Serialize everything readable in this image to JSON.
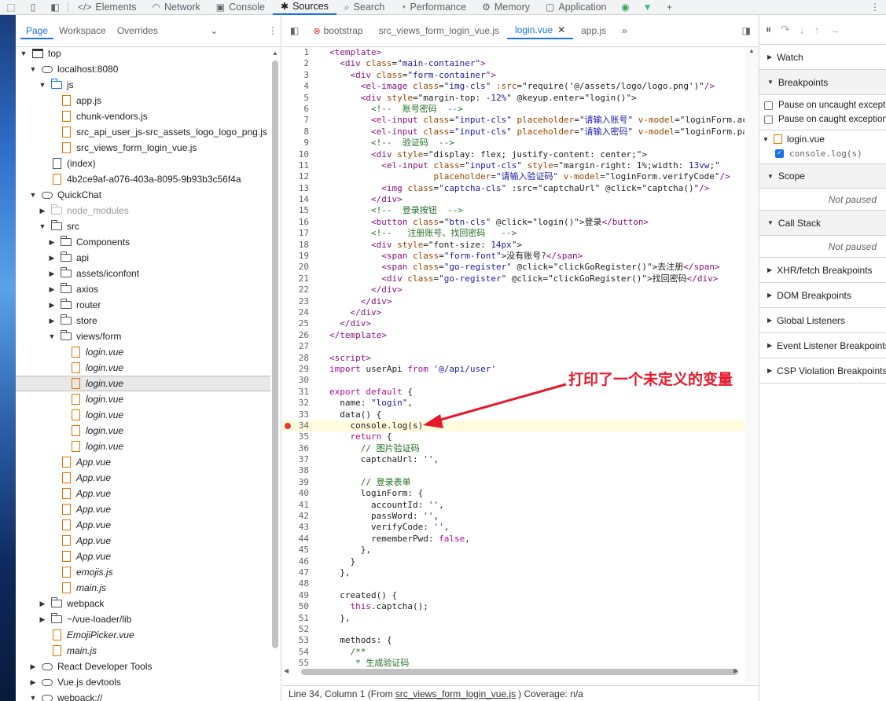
{
  "toolbar": {
    "tabs": [
      {
        "label": "Elements",
        "icon": "code-icon"
      },
      {
        "label": "Network",
        "icon": "wifi-icon"
      },
      {
        "label": "Console",
        "icon": "console-icon"
      },
      {
        "label": "Sources",
        "icon": "bug-icon"
      },
      {
        "label": "Search",
        "icon": "search-icon"
      },
      {
        "label": "Performance",
        "icon": "performance-icon"
      },
      {
        "label": "Memory",
        "icon": "memory-icon"
      },
      {
        "label": "Application",
        "icon": "application-icon"
      }
    ],
    "active_tab": "Sources",
    "add": "+",
    "more": "⋮"
  },
  "navigator": {
    "tabs": [
      "Page",
      "Workspace",
      "Overrides"
    ],
    "active_tab": "Page",
    "tree": [
      {
        "label": "top",
        "depth": 0,
        "icon": "frame",
        "open": true
      },
      {
        "label": "localhost:8080",
        "depth": 1,
        "icon": "cloud",
        "open": true
      },
      {
        "label": "js",
        "depth": 2,
        "icon": "folder-blue",
        "open": true
      },
      {
        "label": "app.js",
        "depth": 3,
        "icon": "file-orange"
      },
      {
        "label": "chunk-vendors.js",
        "depth": 3,
        "icon": "file-orange"
      },
      {
        "label": "src_api_user_js-src_assets_logo_logo_png.js",
        "depth": 3,
        "icon": "file-orange"
      },
      {
        "label": "src_views_form_login_vue.js",
        "depth": 3,
        "icon": "file-orange"
      },
      {
        "label": "(index)",
        "depth": 2,
        "icon": "file"
      },
      {
        "label": "4b2ce9af-a076-403a-8095-9b93b3c56f4a",
        "depth": 2,
        "icon": "file-orange"
      },
      {
        "label": "QuickChat",
        "depth": 1,
        "icon": "cloud",
        "open": true
      },
      {
        "label": "node_modules",
        "depth": 2,
        "icon": "folder-grey",
        "open": false,
        "dim": true
      },
      {
        "label": "src",
        "depth": 2,
        "icon": "folder",
        "open": true
      },
      {
        "label": "Components",
        "depth": 3,
        "icon": "folder",
        "open": false
      },
      {
        "label": "api",
        "depth": 3,
        "icon": "folder",
        "open": false
      },
      {
        "label": "assets/iconfont",
        "depth": 3,
        "icon": "folder",
        "open": false
      },
      {
        "label": "axios",
        "depth": 3,
        "icon": "folder",
        "open": false
      },
      {
        "label": "router",
        "depth": 3,
        "icon": "folder",
        "open": false
      },
      {
        "label": "store",
        "depth": 3,
        "icon": "folder",
        "open": false
      },
      {
        "label": "views/form",
        "depth": 3,
        "icon": "folder",
        "open": true
      },
      {
        "label": "login.vue",
        "depth": 4,
        "icon": "file-orange",
        "italic": true
      },
      {
        "label": "login.vue",
        "depth": 4,
        "icon": "file-orange",
        "italic": true
      },
      {
        "label": "login.vue",
        "depth": 4,
        "icon": "file-orange",
        "italic": true,
        "selected": true
      },
      {
        "label": "login.vue",
        "depth": 4,
        "icon": "file-orange",
        "italic": true
      },
      {
        "label": "login.vue",
        "depth": 4,
        "icon": "file-orange",
        "italic": true
      },
      {
        "label": "login.vue",
        "depth": 4,
        "icon": "file-orange",
        "italic": true
      },
      {
        "label": "login.vue",
        "depth": 4,
        "icon": "file-orange",
        "italic": true
      },
      {
        "label": "App.vue",
        "depth": 3,
        "icon": "file-orange",
        "italic": true
      },
      {
        "label": "App.vue",
        "depth": 3,
        "icon": "file-orange",
        "italic": true
      },
      {
        "label": "App.vue",
        "depth": 3,
        "icon": "file-orange",
        "italic": true
      },
      {
        "label": "App.vue",
        "depth": 3,
        "icon": "file-orange",
        "italic": true
      },
      {
        "label": "App.vue",
        "depth": 3,
        "icon": "file-orange",
        "italic": true
      },
      {
        "label": "App.vue",
        "depth": 3,
        "icon": "file-orange",
        "italic": true
      },
      {
        "label": "App.vue",
        "depth": 3,
        "icon": "file-orange",
        "italic": true
      },
      {
        "label": "emojis.js",
        "depth": 3,
        "icon": "file-orange",
        "italic": true
      },
      {
        "label": "main.js",
        "depth": 3,
        "icon": "file-orange",
        "italic": true
      },
      {
        "label": "webpack",
        "depth": 2,
        "icon": "folder",
        "open": false
      },
      {
        "label": "~/vue-loader/lib",
        "depth": 2,
        "icon": "folder",
        "open": false
      },
      {
        "label": "EmojiPicker.vue",
        "depth": 2,
        "icon": "file-orange",
        "italic": true,
        "leaf": true
      },
      {
        "label": "main.js",
        "depth": 2,
        "icon": "file-orange",
        "italic": true,
        "leaf": true
      },
      {
        "label": "React Developer Tools",
        "depth": 1,
        "icon": "cloud",
        "open": false
      },
      {
        "label": "Vue.js devtools",
        "depth": 1,
        "icon": "cloud",
        "open": false
      },
      {
        "label": "webpack://",
        "depth": 1,
        "icon": "cloud",
        "open": true
      }
    ]
  },
  "editor": {
    "tabs": [
      {
        "label": "bootstrap",
        "error": true
      },
      {
        "label": "src_views_form_login_vue.js"
      },
      {
        "label": "login.vue",
        "active": true,
        "closable": true
      },
      {
        "label": "app.js"
      }
    ],
    "breakpoint_line": 34,
    "lines": [
      [
        {
          "t": "<template>",
          "c": "tag"
        }
      ],
      [
        {
          "t": "  <div ",
          "c": "tag"
        },
        {
          "t": "class",
          "c": "attr"
        },
        {
          "t": "=",
          "c": ""
        },
        {
          "t": "\"main-container\"",
          "c": "str"
        },
        {
          "t": ">",
          "c": "tag"
        }
      ],
      [
        {
          "t": "    <div ",
          "c": "tag"
        },
        {
          "t": "class",
          "c": "attr"
        },
        {
          "t": "=",
          "c": ""
        },
        {
          "t": "\"form-container\"",
          "c": "str"
        },
        {
          "t": ">",
          "c": "tag"
        }
      ],
      [
        {
          "t": "      <el-image ",
          "c": "tag"
        },
        {
          "t": "class",
          "c": "attr"
        },
        {
          "t": "=",
          "c": ""
        },
        {
          "t": "\"img-cls\"",
          "c": "str"
        },
        {
          "t": " :src",
          "c": "attr"
        },
        {
          "t": "=\"require('@/assets/logo/logo.png')\"",
          "c": ""
        },
        {
          "t": "/>",
          "c": "tag"
        }
      ],
      [
        {
          "t": "      <div ",
          "c": "tag"
        },
        {
          "t": "style",
          "c": "attr"
        },
        {
          "t": "=\"margin-top: ",
          "c": ""
        },
        {
          "t": "-12%",
          "c": "str"
        },
        {
          "t": "\" @keyup.enter=\"login()\">",
          "c": ""
        }
      ],
      [
        {
          "t": "        <!--  账号密码  -->",
          "c": "cm"
        }
      ],
      [
        {
          "t": "        <el-input ",
          "c": "tag"
        },
        {
          "t": "class",
          "c": "attr"
        },
        {
          "t": "=",
          "c": ""
        },
        {
          "t": "\"input-cls\"",
          "c": "str"
        },
        {
          "t": " placeholder",
          "c": "attr"
        },
        {
          "t": "=",
          "c": ""
        },
        {
          "t": "\"请输入账号\"",
          "c": "str"
        },
        {
          "t": " v-model",
          "c": "attr"
        },
        {
          "t": "=\"loginForm.ac",
          "c": ""
        }
      ],
      [
        {
          "t": "        <el-input ",
          "c": "tag"
        },
        {
          "t": "class",
          "c": "attr"
        },
        {
          "t": "=",
          "c": ""
        },
        {
          "t": "\"input-cls\"",
          "c": "str"
        },
        {
          "t": " placeholder",
          "c": "attr"
        },
        {
          "t": "=",
          "c": ""
        },
        {
          "t": "\"请输入密码\"",
          "c": "str"
        },
        {
          "t": " v-model",
          "c": "attr"
        },
        {
          "t": "=\"loginForm.pa",
          "c": ""
        }
      ],
      [
        {
          "t": "        <!--  验证码  -->",
          "c": "cm"
        }
      ],
      [
        {
          "t": "        <div ",
          "c": "tag"
        },
        {
          "t": "style",
          "c": "attr"
        },
        {
          "t": "=\"display: flex; justify-content: center;\">",
          "c": ""
        }
      ],
      [
        {
          "t": "          <el-input ",
          "c": "tag"
        },
        {
          "t": "class",
          "c": "attr"
        },
        {
          "t": "=",
          "c": ""
        },
        {
          "t": "\"input-cls\"",
          "c": "str"
        },
        {
          "t": " style",
          "c": "attr"
        },
        {
          "t": "=\"margin-right: 1%;width: ",
          "c": ""
        },
        {
          "t": "13vw",
          "c": "str"
        },
        {
          "t": ";\"",
          "c": ""
        }
      ],
      [
        {
          "t": "                    placeholder",
          "c": "attr"
        },
        {
          "t": "=",
          "c": ""
        },
        {
          "t": "\"请输入验证码\"",
          "c": "str"
        },
        {
          "t": " v-model",
          "c": "attr"
        },
        {
          "t": "=\"loginForm.verifyCode\"",
          "c": ""
        },
        {
          "t": "/>",
          "c": "tag"
        }
      ],
      [
        {
          "t": "          <img ",
          "c": "tag"
        },
        {
          "t": "class",
          "c": "attr"
        },
        {
          "t": "=",
          "c": ""
        },
        {
          "t": "\"captcha-cls\"",
          "c": "str"
        },
        {
          "t": " :src=\"captchaUrl\" @click=\"captcha()\"",
          "c": ""
        },
        {
          "t": "/>",
          "c": "tag"
        }
      ],
      [
        {
          "t": "        </div>",
          "c": "tag"
        }
      ],
      [
        {
          "t": "        <!--  登录按钮  -->",
          "c": "cm"
        }
      ],
      [
        {
          "t": "        <button ",
          "c": "tag"
        },
        {
          "t": "class",
          "c": "attr"
        },
        {
          "t": "=",
          "c": ""
        },
        {
          "t": "\"btn-cls\"",
          "c": "str"
        },
        {
          "t": " @click=\"login()\">登录",
          "c": ""
        },
        {
          "t": "</button>",
          "c": "tag"
        }
      ],
      [
        {
          "t": "        <!--   注册账号、找回密码   -->",
          "c": "cm"
        }
      ],
      [
        {
          "t": "        <div ",
          "c": "tag"
        },
        {
          "t": "style",
          "c": "attr"
        },
        {
          "t": "=\"font-size: ",
          "c": ""
        },
        {
          "t": "14px",
          "c": "str"
        },
        {
          "t": "\">",
          "c": ""
        }
      ],
      [
        {
          "t": "          <span ",
          "c": "tag"
        },
        {
          "t": "class",
          "c": "attr"
        },
        {
          "t": "=",
          "c": ""
        },
        {
          "t": "\"form-font\"",
          "c": "str"
        },
        {
          "t": ">没有账号?",
          "c": ""
        },
        {
          "t": "</span>",
          "c": "tag"
        }
      ],
      [
        {
          "t": "          <span ",
          "c": "tag"
        },
        {
          "t": "class",
          "c": "attr"
        },
        {
          "t": "=",
          "c": ""
        },
        {
          "t": "\"go-register\"",
          "c": "str"
        },
        {
          "t": " @click=\"clickGoRegister()\">去注册",
          "c": ""
        },
        {
          "t": "</span>",
          "c": "tag"
        }
      ],
      [
        {
          "t": "          <div ",
          "c": "tag"
        },
        {
          "t": "class",
          "c": "attr"
        },
        {
          "t": "=",
          "c": ""
        },
        {
          "t": "\"go-register\"",
          "c": "str"
        },
        {
          "t": " @click=\"clickGoRegister()\">找回密码",
          "c": ""
        },
        {
          "t": "</div>",
          "c": "tag"
        }
      ],
      [
        {
          "t": "        </div>",
          "c": "tag"
        }
      ],
      [
        {
          "t": "      </div>",
          "c": "tag"
        }
      ],
      [
        {
          "t": "    </div>",
          "c": "tag"
        }
      ],
      [
        {
          "t": "  </div>",
          "c": "tag"
        }
      ],
      [
        {
          "t": "</template>",
          "c": "tag"
        }
      ],
      [
        {
          "t": "",
          "c": ""
        }
      ],
      [
        {
          "t": "<script>",
          "c": "tag"
        }
      ],
      [
        {
          "t": "import ",
          "c": "kw"
        },
        {
          "t": "userApi ",
          "c": ""
        },
        {
          "t": "from ",
          "c": "kw"
        },
        {
          "t": "'@/api/user'",
          "c": "str"
        }
      ],
      [
        {
          "t": "",
          "c": ""
        }
      ],
      [
        {
          "t": "export default ",
          "c": "kw"
        },
        {
          "t": "{",
          "c": ""
        }
      ],
      [
        {
          "t": "  name: ",
          "c": ""
        },
        {
          "t": "\"login\"",
          "c": "str"
        },
        {
          "t": ",",
          "c": ""
        }
      ],
      [
        {
          "t": "  data() {",
          "c": ""
        }
      ],
      [
        {
          "t": "    console.log(s)",
          "c": ""
        }
      ],
      [
        {
          "t": "    return ",
          "c": "kw"
        },
        {
          "t": "{",
          "c": ""
        }
      ],
      [
        {
          "t": "      // 图片验证码",
          "c": "cm"
        }
      ],
      [
        {
          "t": "      captchaUrl: ",
          "c": ""
        },
        {
          "t": "''",
          "c": "str"
        },
        {
          "t": ",",
          "c": ""
        }
      ],
      [
        {
          "t": "",
          "c": ""
        }
      ],
      [
        {
          "t": "      // 登录表单",
          "c": "cm"
        }
      ],
      [
        {
          "t": "      loginForm: {",
          "c": ""
        }
      ],
      [
        {
          "t": "        accountId: ",
          "c": ""
        },
        {
          "t": "''",
          "c": "str"
        },
        {
          "t": ",",
          "c": ""
        }
      ],
      [
        {
          "t": "        passWord: ",
          "c": ""
        },
        {
          "t": "''",
          "c": "str"
        },
        {
          "t": ",",
          "c": ""
        }
      ],
      [
        {
          "t": "        verifyCode: ",
          "c": ""
        },
        {
          "t": "''",
          "c": "str"
        },
        {
          "t": ",",
          "c": ""
        }
      ],
      [
        {
          "t": "        rememberPwd: ",
          "c": ""
        },
        {
          "t": "false",
          "c": "kw"
        },
        {
          "t": ",",
          "c": ""
        }
      ],
      [
        {
          "t": "      },",
          "c": ""
        }
      ],
      [
        {
          "t": "    }",
          "c": ""
        }
      ],
      [
        {
          "t": "  },",
          "c": ""
        }
      ],
      [
        {
          "t": "",
          "c": ""
        }
      ],
      [
        {
          "t": "  created() {",
          "c": ""
        }
      ],
      [
        {
          "t": "    this",
          "c": "kw"
        },
        {
          "t": ".captcha();",
          "c": ""
        }
      ],
      [
        {
          "t": "  },",
          "c": ""
        }
      ],
      [
        {
          "t": "",
          "c": ""
        }
      ],
      [
        {
          "t": "  methods: {",
          "c": ""
        }
      ],
      [
        {
          "t": "    /**",
          "c": "cm"
        }
      ],
      [
        {
          "t": "     * 生成验证码",
          "c": "cm"
        }
      ]
    ],
    "status": {
      "position": "Line 34, Column 1",
      "from_prefix": "(From",
      "from_link": "src_views_form_login_vue.js",
      "from_suffix": ")",
      "coverage": "Coverage: n/a"
    }
  },
  "annotation": "打印了一个未定义的变量",
  "debugger": {
    "sections": {
      "watch": "Watch",
      "breakpoints": "Breakpoints",
      "pause_uncaught": "Pause on uncaught except",
      "pause_caught": "Pause on caught exception",
      "bp_file": "login.vue",
      "bp_line": "console.log(s)",
      "scope": "Scope",
      "not_paused_1": "Not paused",
      "call_stack": "Call Stack",
      "not_paused_2": "Not paused",
      "xhr": "XHR/fetch Breakpoints",
      "dom": "DOM Breakpoints",
      "global": "Global Listeners",
      "event": "Event Listener Breakpoints",
      "csp": "CSP Violation Breakpoints"
    }
  },
  "colors": {
    "accent": "#1a73e8",
    "breakpoint": "#e53935",
    "annotation": "#e5192b",
    "highlight_line": "#fffbdd"
  }
}
